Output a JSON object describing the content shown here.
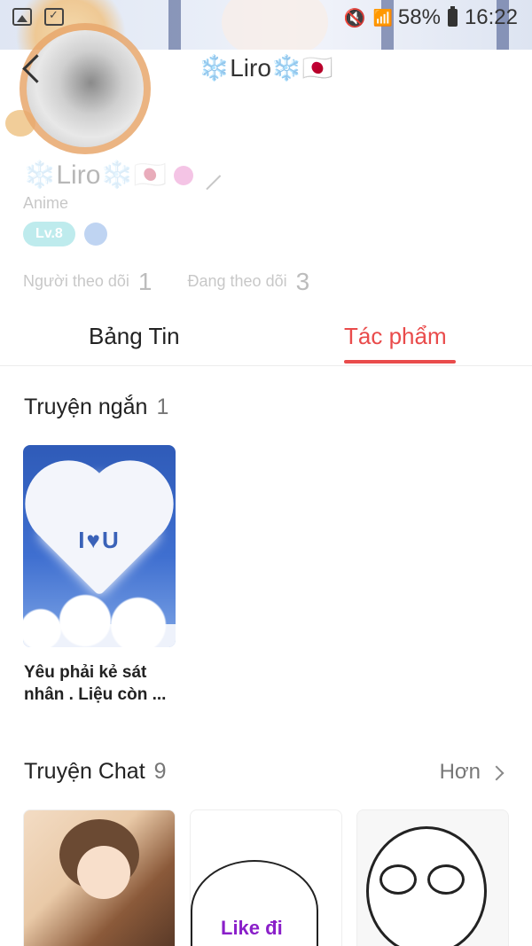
{
  "status_bar": {
    "battery": "58%",
    "time": "16:22",
    "icons": [
      "image-icon",
      "task-icon",
      "mute-icon",
      "wifi-icon",
      "signal-icon",
      "battery-icon"
    ]
  },
  "header": {
    "title": "❄️Liro❄️🇯🇵"
  },
  "profile": {
    "name": "❄️Liro❄️🇯🇵",
    "subtitle": "Anime",
    "level": "Lv.8",
    "followers_label": "Người theo dõi",
    "followers_count": "1",
    "following_label": "Đang theo dõi",
    "following_count": "3"
  },
  "tabs": [
    {
      "label": "Bảng Tin",
      "active": false
    },
    {
      "label": "Tác phẩm",
      "active": true
    }
  ],
  "short_stories": {
    "title": "Truyện ngắn",
    "count": "1",
    "items": [
      {
        "title": "Yêu phải kẻ sát nhân . Liệu còn ..."
      }
    ]
  },
  "chat_stories": {
    "title": "Truyện Chat",
    "count": "9",
    "more_label": "Hơn",
    "items": [
      {
        "cover_text": ""
      },
      {
        "cover_text": "Like đi"
      },
      {
        "cover_text": ""
      }
    ]
  },
  "colors": {
    "accent": "#e94b4b",
    "level_badge": "#37c2c8"
  }
}
